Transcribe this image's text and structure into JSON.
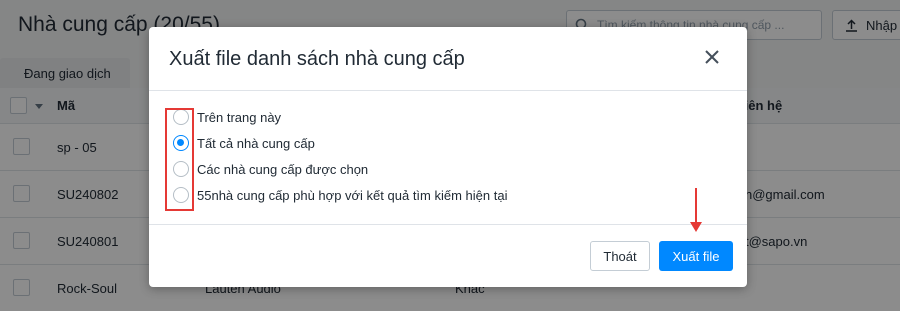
{
  "page": {
    "title": "Nhà cung cấp (20/55)",
    "search_placeholder": "Tìm kiếm thông tin nhà cung cấp ...",
    "import_label": "Nhập",
    "active_tab": "Đang giao dịch",
    "table": {
      "headers": {
        "code": "Mã",
        "contact": "liên hệ"
      },
      "rows": [
        {
          "code": "sp - 05",
          "col3": "",
          "col4": "",
          "contact": ""
        },
        {
          "code": "SU240802",
          "col3": "",
          "col4": "",
          "contact": "n@gmail.com"
        },
        {
          "code": "SU240801",
          "col3": "",
          "col4": "",
          "contact": "t@sapo.vn"
        },
        {
          "code": "Rock-Soul",
          "col3": "Lauten Audio",
          "col4": "Khác",
          "contact": ""
        }
      ]
    }
  },
  "modal": {
    "title": "Xuất file danh sách nhà cung cấp",
    "options": [
      {
        "label": "Trên trang này",
        "checked": false
      },
      {
        "label": "Tất cả nhà cung cấp",
        "checked": true
      },
      {
        "label": "Các nhà cung cấp được chọn",
        "checked": false
      },
      {
        "label": "55nhà cung cấp phù hợp với kết quả tìm kiếm hiện tại",
        "checked": false
      }
    ],
    "cancel_label": "Thoát",
    "export_label": "Xuất file"
  },
  "colors": {
    "primary": "#0088ff",
    "annotation": "#e53935",
    "overlay": "rgba(0,0,0,0.45)"
  }
}
